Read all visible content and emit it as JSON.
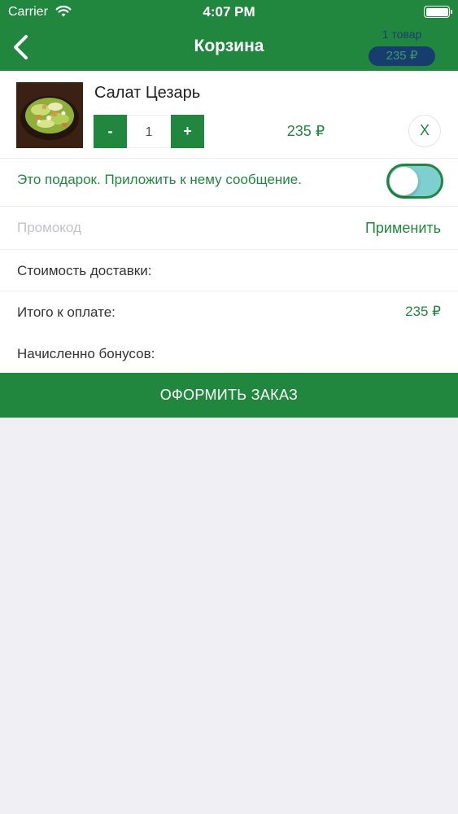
{
  "status_bar": {
    "carrier": "Carrier",
    "time": "4:07 PM",
    "wifi_icon": "wifi-icon",
    "battery_icon": "battery-icon"
  },
  "nav": {
    "back_icon": "chevron-left-icon",
    "title": "Корзина",
    "items_count": "1 товар",
    "total_badge": "235 ₽"
  },
  "cart_item": {
    "name": "Салат Цезарь",
    "image": "caesar-salad-photo",
    "minus_label": "-",
    "quantity": "1",
    "plus_label": "+",
    "price": "235 ₽",
    "remove_label": "X"
  },
  "gift": {
    "text": "Это подарок. Приложить к нему сообщение.",
    "toggle_on": true
  },
  "promo": {
    "value": "",
    "placeholder": "Промокод",
    "apply_label": "Применить"
  },
  "summary": {
    "delivery_label": "Стоимость доставки:",
    "delivery_value": "",
    "total_label": "Итого к оплате:",
    "total_value": "235 ₽",
    "bonus_label": "Начисленно бонусов:",
    "bonus_value": ""
  },
  "checkout_label": "ОФОРМИТЬ ЗАКАЗ",
  "colors": {
    "accent": "#21873f",
    "badge_bg": "#173d6e",
    "toggle_track": "#7dcfd0",
    "background": "#efeff4"
  }
}
